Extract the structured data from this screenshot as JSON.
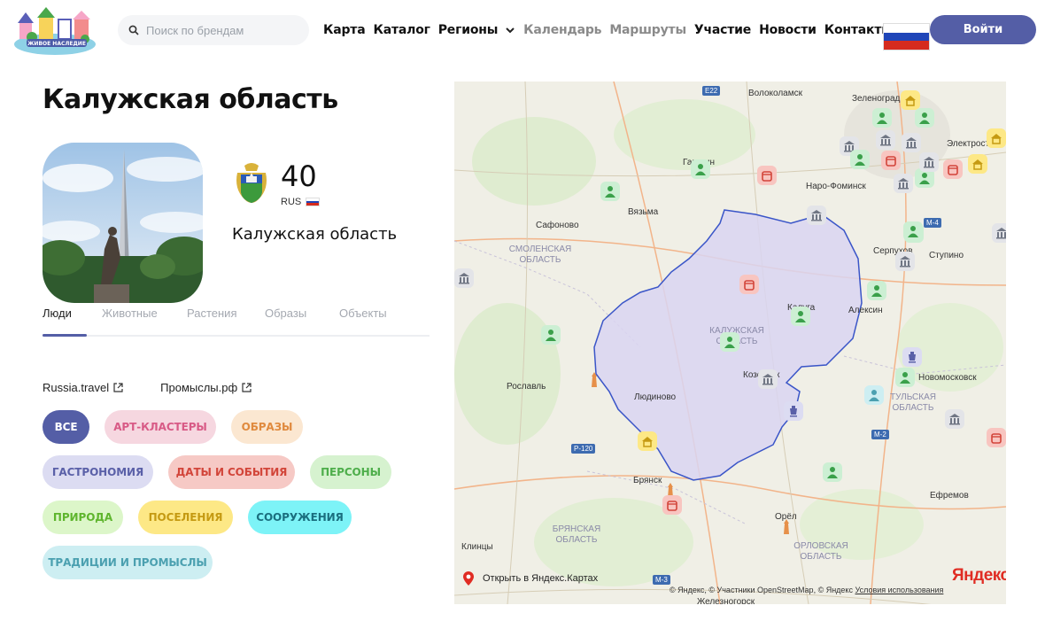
{
  "header": {
    "logo_text": "ЖИВОЕ НАСЛЕДИЕ",
    "search_placeholder": "Поиск по брендам",
    "nav": [
      {
        "label": "Карта",
        "muted": false
      },
      {
        "label": "Каталог",
        "muted": false
      },
      {
        "label": "Регионы",
        "muted": false
      },
      {
        "label": "Календарь",
        "muted": true
      },
      {
        "label": "Маршруты",
        "muted": true
      },
      {
        "label": "Участие",
        "muted": false
      },
      {
        "label": "Новости",
        "muted": false
      },
      {
        "label": "Контакты",
        "muted": false
      }
    ],
    "login_label": "Войти",
    "flag_colors": [
      "#ffffff",
      "#1f45b8",
      "#d52b1e"
    ]
  },
  "region": {
    "title": "Калужская область",
    "count": "40",
    "country_code": "RUS",
    "name": "Калужская область"
  },
  "tabs": [
    "Люди",
    "Животные",
    "Растения",
    "Образы",
    "Объекты"
  ],
  "active_tab": "Люди",
  "links": [
    "Russia.travel",
    "Промыслы.рф"
  ],
  "chips": [
    {
      "label": "ВСЕ",
      "bg": "#545ea6",
      "fg": "#ffffff"
    },
    {
      "label": "АРТ-КЛАСТЕРЫ",
      "bg": "#f6d7e0",
      "fg": "#d85a86"
    },
    {
      "label": "ОБРАЗЫ",
      "bg": "#fbe7d1",
      "fg": "#e08a3e"
    },
    {
      "label": "ГАСТРОНОМИЯ",
      "bg": "#dcdcf2",
      "fg": "#5a60a8"
    },
    {
      "label": "ДАТЫ И СОБЫТИЯ",
      "bg": "#f6c9c5",
      "fg": "#d2453a"
    },
    {
      "label": "ПЕРСОНЫ",
      "bg": "#d6f2cf",
      "fg": "#4eae4b"
    },
    {
      "label": "ПРИРОДА",
      "bg": "#dcf6c9",
      "fg": "#5eb52d"
    },
    {
      "label": "ПОСЕЛЕНИЯ",
      "bg": "#fde886",
      "fg": "#c59a12"
    },
    {
      "label": "СООРУЖЕНИЯ",
      "bg": "#7df3f7",
      "fg": "#1b6f7f"
    },
    {
      "label": "ТРАДИЦИИ И ПРОМЫСЛЫ",
      "bg": "#cdeef2",
      "fg": "#4ba0b0"
    }
  ],
  "map": {
    "open_label": "Открыть в Яндекс.Картах",
    "attribution": "© Яндекс, © Участники OpenStreetMap, © Яндекс",
    "terms": "Условия использования",
    "brand": "Яндекс",
    "cities": [
      "Волоколамск",
      "Зеленоград",
      "Гагарин",
      "Наро-Фоминск",
      "Электросталь",
      "Вязьма",
      "Сафоново",
      "Серпухов",
      "Ступино",
      "Калуга",
      "Алексин",
      "Рославль",
      "Людиново",
      "Козельск",
      "Новомосковск",
      "Брянск",
      "Ефремов",
      "Орёл",
      "Клинцы",
      "Железногорск"
    ],
    "regions": [
      "СМОЛЕНСКАЯ ОБЛАСТЬ",
      "КАЛУЖСКАЯ ОБЛАСТЬ",
      "ТУЛЬСКАЯ ОБЛАСТЬ",
      "БРЯНСКАЯ ОБЛАСТЬ",
      "ОРЛОВСКАЯ ОБЛАСТЬ"
    ],
    "roads": [
      "E22",
      "M-4",
      "M-2",
      "P-120",
      "M-3"
    ]
  }
}
